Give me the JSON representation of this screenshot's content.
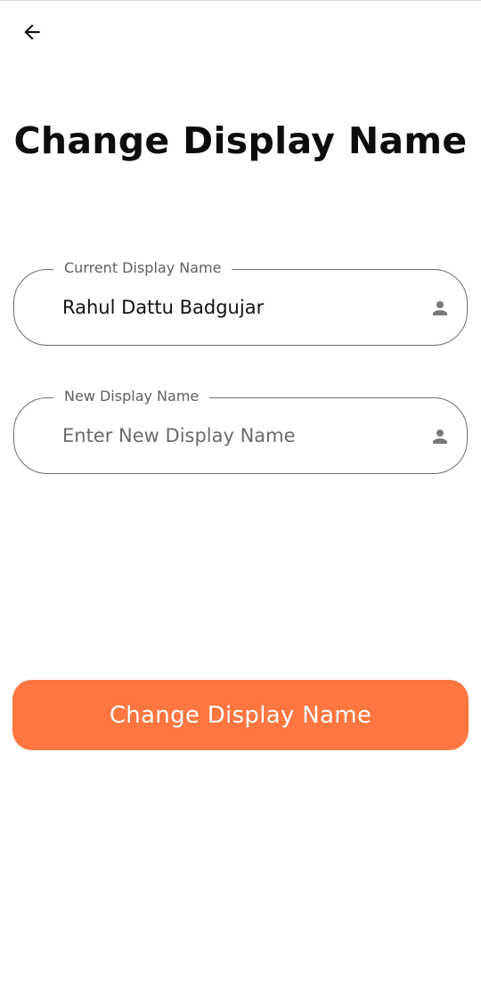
{
  "header": {
    "back_icon": "arrow-left-icon"
  },
  "page": {
    "title": "Change Display Name"
  },
  "current_field": {
    "label": "Current Display Name",
    "value": "Rahul Dattu Badgujar",
    "icon": "person-icon"
  },
  "new_field": {
    "label": "New Display Name",
    "value": "",
    "placeholder": "Enter New Display Name",
    "icon": "person-icon"
  },
  "submit_button": {
    "label": "Change Display Name"
  },
  "colors": {
    "accent": "#ff7640",
    "field_border": "#6e6e6e",
    "label_text": "#5f5f5f",
    "icon": "#7a7a7a"
  }
}
